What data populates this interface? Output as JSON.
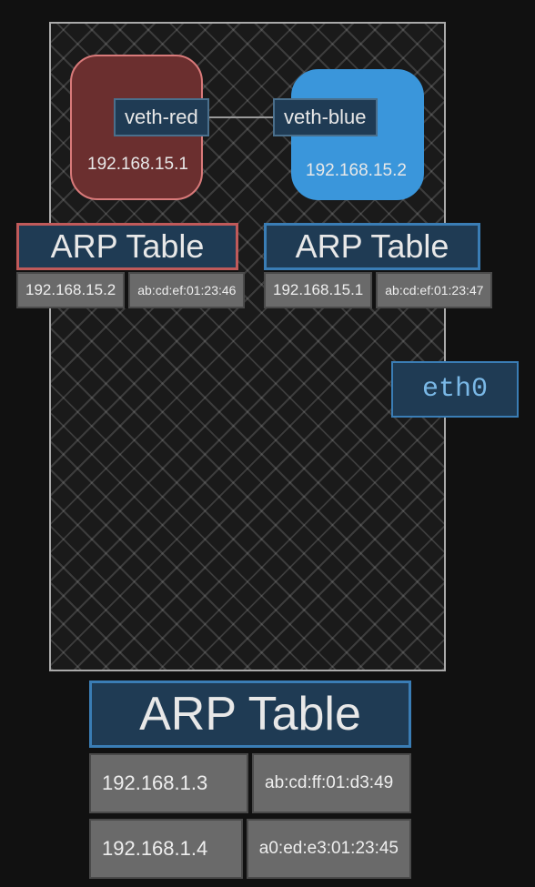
{
  "namespaces": {
    "red": {
      "veth_label": "veth-red",
      "ip": "192.168.15.1",
      "color": "#6b2f2f",
      "border": "#d97a7a"
    },
    "blue": {
      "veth_label": "veth-blue",
      "ip": "192.168.15.2",
      "color": "#3a96db",
      "border": "#3a96db"
    }
  },
  "arp_red": {
    "title": "ARP Table",
    "rows": [
      {
        "ip": "192.168.15.2",
        "mac": "ab:cd:ef:01:23:46"
      }
    ]
  },
  "arp_blue": {
    "title": "ARP Table",
    "rows": [
      {
        "ip": "192.168.15.1",
        "mac": "ab:cd:ef:01:23:47"
      }
    ]
  },
  "host": {
    "interface": "eth0"
  },
  "arp_host": {
    "title": "ARP Table",
    "rows": [
      {
        "ip": "192.168.1.3",
        "mac": "ab:cd:ff:01:d3:49"
      },
      {
        "ip": "192.168.1.4",
        "mac": "a0:ed:e3:01:23:45"
      }
    ]
  }
}
